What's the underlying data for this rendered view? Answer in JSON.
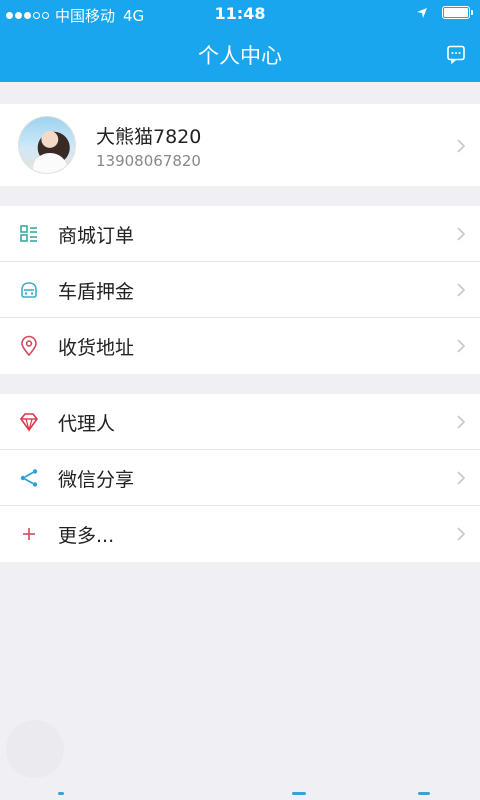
{
  "status_bar": {
    "carrier": "中国移动",
    "network": "4G",
    "time": "11:48",
    "signal_dots_filled": 3,
    "signal_dots_total": 5,
    "battery_level": 1.0
  },
  "nav": {
    "title": "个人中心",
    "message_icon": "message-icon"
  },
  "profile": {
    "name": "大熊猫7820",
    "phone": "13908067820"
  },
  "menu_group_1": [
    {
      "label": "商城订单",
      "icon": "order-list-icon",
      "color": "#3aa8a0"
    },
    {
      "label": "车盾押金",
      "icon": "car-shield-icon",
      "color": "#3ab0c8"
    },
    {
      "label": "收货地址",
      "icon": "location-pin-icon",
      "color": "#d0495c"
    }
  ],
  "menu_group_2": [
    {
      "label": "代理人",
      "icon": "diamond-icon",
      "color": "#d8384a"
    },
    {
      "label": "微信分享",
      "icon": "share-icon",
      "color": "#2a9fd8"
    },
    {
      "label": "更多...",
      "icon": "plus-icon",
      "color": "#d0495c"
    }
  ],
  "colors": {
    "primary": "#1aa6ef",
    "background": "#efeff4",
    "text": "#222222",
    "subtext": "#888888"
  }
}
